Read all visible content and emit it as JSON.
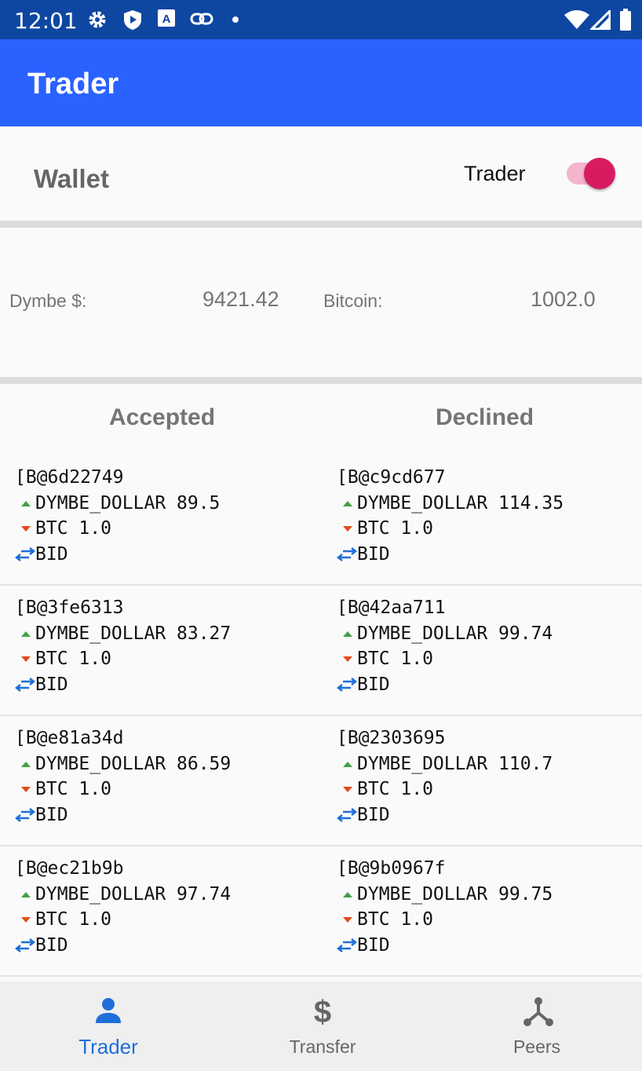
{
  "status_bar": {
    "time": "12:01"
  },
  "app_bar": {
    "title": "Trader"
  },
  "wallet": {
    "title": "Wallet",
    "toggle_label": "Trader",
    "toggle_on": true,
    "dymbe_label": "Dymbe $:",
    "dymbe_value": "9421.42",
    "bitcoin_label": "Bitcoin:",
    "bitcoin_value": "1002.0"
  },
  "columns": {
    "accepted": "Accepted",
    "declined": "Declined"
  },
  "rows": [
    {
      "accepted": {
        "id": "[B@6d22749",
        "dymbe": "DYMBE_DOLLAR 89.5",
        "btc": "BTC 1.0",
        "type": "BID"
      },
      "declined": {
        "id": "[B@c9cd677",
        "dymbe": "DYMBE_DOLLAR 114.35",
        "btc": "BTC 1.0",
        "type": "BID"
      }
    },
    {
      "accepted": {
        "id": "[B@3fe6313",
        "dymbe": "DYMBE_DOLLAR 83.27",
        "btc": "BTC 1.0",
        "type": "BID"
      },
      "declined": {
        "id": "[B@42aa711",
        "dymbe": "DYMBE_DOLLAR 99.74",
        "btc": "BTC 1.0",
        "type": "BID"
      }
    },
    {
      "accepted": {
        "id": "[B@e81a34d",
        "dymbe": "DYMBE_DOLLAR 86.59",
        "btc": "BTC 1.0",
        "type": "BID"
      },
      "declined": {
        "id": "[B@2303695",
        "dymbe": "DYMBE_DOLLAR 110.7",
        "btc": "BTC 1.0",
        "type": "BID"
      }
    },
    {
      "accepted": {
        "id": "[B@ec21b9b",
        "dymbe": "DYMBE_DOLLAR 97.74",
        "btc": "BTC 1.0",
        "type": "BID"
      },
      "declined": {
        "id": "[B@9b0967f",
        "dymbe": "DYMBE_DOLLAR 99.75",
        "btc": "BTC 1.0",
        "type": "BID"
      }
    }
  ],
  "bottom_nav": {
    "items": [
      {
        "label": "Trader",
        "icon": "person-icon",
        "active": true
      },
      {
        "label": "Transfer",
        "icon": "dollar-icon",
        "active": false
      },
      {
        "label": "Peers",
        "icon": "peers-network-icon",
        "active": false
      }
    ]
  },
  "colors": {
    "status_bar": "#0d47a1",
    "app_bar": "#2962ff",
    "toggle_accent": "#d81b60",
    "up_arrow": "#43a047",
    "down_arrow": "#e64a19",
    "swap_icon": "#1e6fd9",
    "nav_active": "#1e6fd9"
  }
}
